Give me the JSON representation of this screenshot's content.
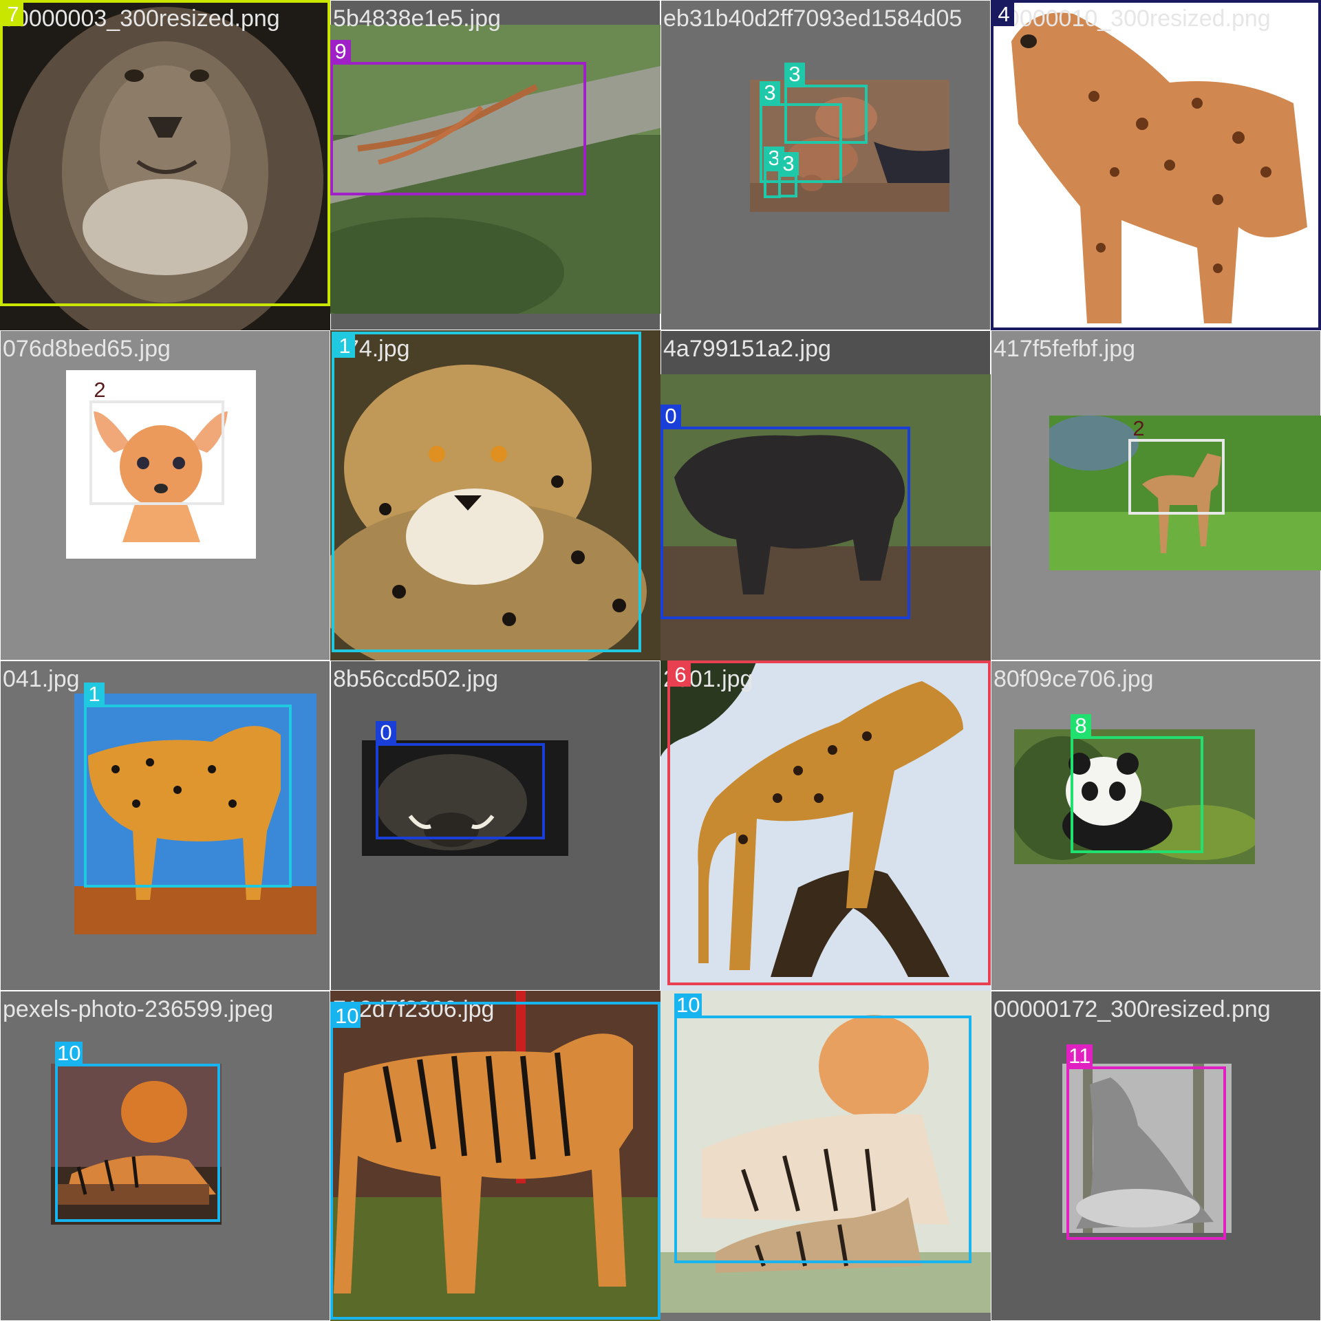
{
  "tiles": [
    {
      "filename": "00000003_300resized.png",
      "boxes": [
        {
          "label": "7",
          "color": "#c8e600"
        }
      ]
    },
    {
      "filename": "5b4838e1e5.jpg",
      "boxes": [
        {
          "label": "9",
          "color": "#a020c8"
        }
      ]
    },
    {
      "filename": "eb31b40d2ff7093ed1584d05",
      "boxes": [
        {
          "label": "3",
          "color": "#1ec8a8"
        },
        {
          "label": "3",
          "color": "#1ec8a8"
        },
        {
          "label": "3",
          "color": "#1ec8a8"
        },
        {
          "label": "3",
          "color": "#1ec8a8"
        }
      ]
    },
    {
      "filename": "00000010_300resized.png",
      "boxes": [
        {
          "label": "4",
          "color": "#1a1a60"
        }
      ]
    },
    {
      "filename": "076d8bed65.jpg",
      "boxes": [
        {
          "label": "2",
          "color": "#e8e8e8"
        }
      ]
    },
    {
      "filename": "074.jpg",
      "boxes": [
        {
          "label": "1",
          "color": "#20c8e0"
        }
      ]
    },
    {
      "filename": "4a799151a2.jpg",
      "boxes": [
        {
          "label": "0",
          "color": "#1a3ed8"
        }
      ]
    },
    {
      "filename": "417f5fefbf.jpg",
      "boxes": [
        {
          "label": "2",
          "color": "#e8e8e8"
        }
      ]
    },
    {
      "filename": "041.jpg",
      "boxes": [
        {
          "label": "1",
          "color": "#20c8e0"
        }
      ]
    },
    {
      "filename": "8b56ccd502.jpg",
      "boxes": [
        {
          "label": "0",
          "color": "#1a3ed8"
        }
      ]
    },
    {
      "filename": "2001.jpg",
      "boxes": [
        {
          "label": "6",
          "color": "#e84050"
        }
      ]
    },
    {
      "filename": "80f09ce706.jpg",
      "boxes": [
        {
          "label": "8",
          "color": "#20e070"
        }
      ]
    },
    {
      "filename": "pexels-photo-236599.jpeg",
      "boxes": [
        {
          "label": "10",
          "color": "#18b4f0"
        }
      ]
    },
    {
      "filename": "712d7f2306.jpg",
      "boxes": [
        {
          "label": "10",
          "color": "#18b4f0"
        }
      ]
    },
    {
      "filename": "",
      "boxes": [
        {
          "label": "10",
          "color": "#18b4f0"
        }
      ]
    },
    {
      "filename": "00000172_300resized.png",
      "boxes": [
        {
          "label": "11",
          "color": "#e020c0"
        }
      ]
    }
  ]
}
